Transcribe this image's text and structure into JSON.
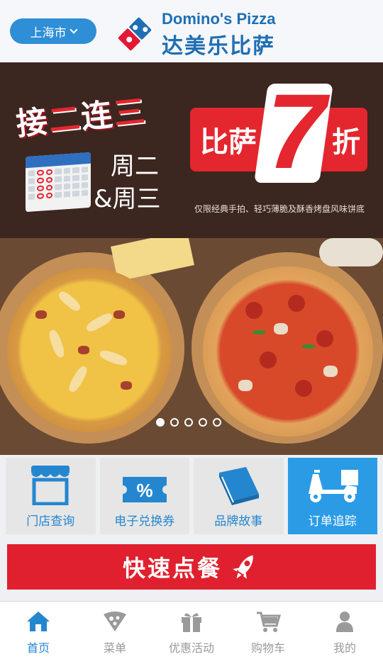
{
  "header": {
    "city_label": "上海市",
    "brand_en": "Domino's Pizza",
    "brand_cn": "达美乐比萨"
  },
  "banner": {
    "headline_prefix": "接",
    "headline_red1": "二",
    "headline_mid": "连",
    "headline_red2": "三",
    "day_line1": "周二",
    "day_line2": "&周三",
    "discount_word": "比萨",
    "discount_number": "7",
    "discount_unit": "折",
    "fine_print": "仅限经典手拍、轻巧薄脆及酥香烤盘风味饼底",
    "slide_count": 5,
    "active_slide": 1
  },
  "tiles": [
    {
      "label": "门店查询",
      "icon": "store-icon",
      "active": false
    },
    {
      "label": "电子兑换券",
      "icon": "coupon-icon",
      "active": false
    },
    {
      "label": "品牌故事",
      "icon": "book-icon",
      "active": false
    },
    {
      "label": "订单追踪",
      "icon": "delivery-scooter-icon",
      "active": true
    }
  ],
  "quick_order": {
    "label": "快速点餐",
    "icon": "rocket-icon"
  },
  "tabbar": [
    {
      "label": "首页",
      "icon": "home-icon",
      "active": true
    },
    {
      "label": "菜单",
      "icon": "pizza-slice-icon",
      "active": false
    },
    {
      "label": "优惠活动",
      "icon": "gift-icon",
      "active": false
    },
    {
      "label": "购物车",
      "icon": "cart-icon",
      "active": false
    },
    {
      "label": "我的",
      "icon": "user-icon",
      "active": false
    }
  ],
  "colors": {
    "primary_blue": "#2586d0",
    "accent_red": "#e0202e",
    "active_tile": "#2b9be6",
    "tab_inactive": "#9a9a9a"
  }
}
